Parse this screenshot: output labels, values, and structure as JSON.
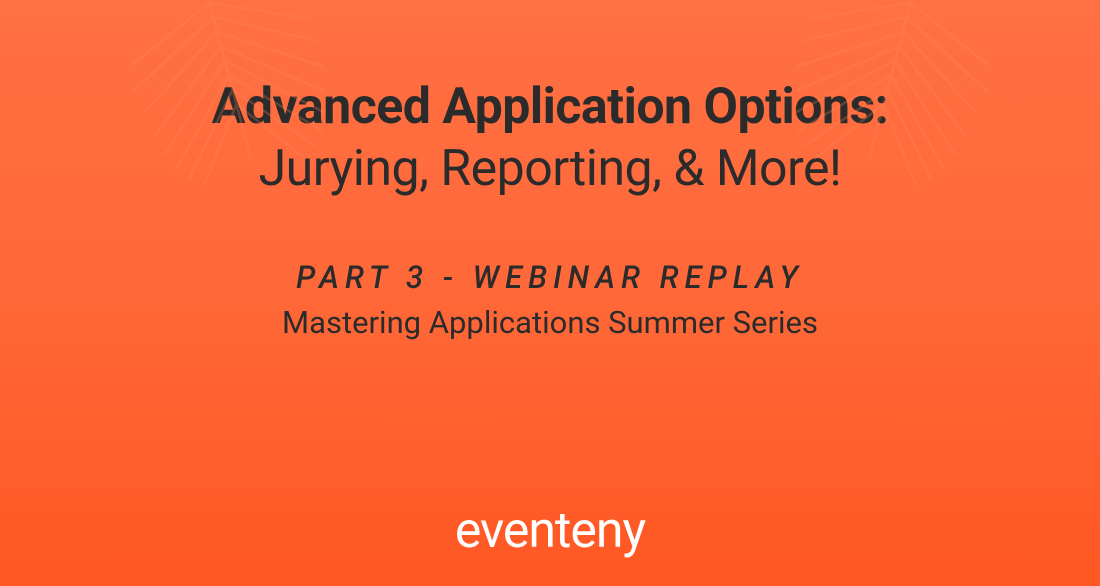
{
  "title": {
    "line1": "Advanced Application Options:",
    "line2": "Jurying, Reporting, & More!"
  },
  "subtitle": {
    "line1": "PART 3 - WEBINAR REPLAY",
    "line2": "Mastering Applications Summer Series"
  },
  "brand": {
    "name": "eventeny"
  },
  "colors": {
    "background_top": "#ff7043",
    "background_bottom": "#ff5722",
    "text": "#2b2b2b",
    "logo": "#ffffff"
  }
}
